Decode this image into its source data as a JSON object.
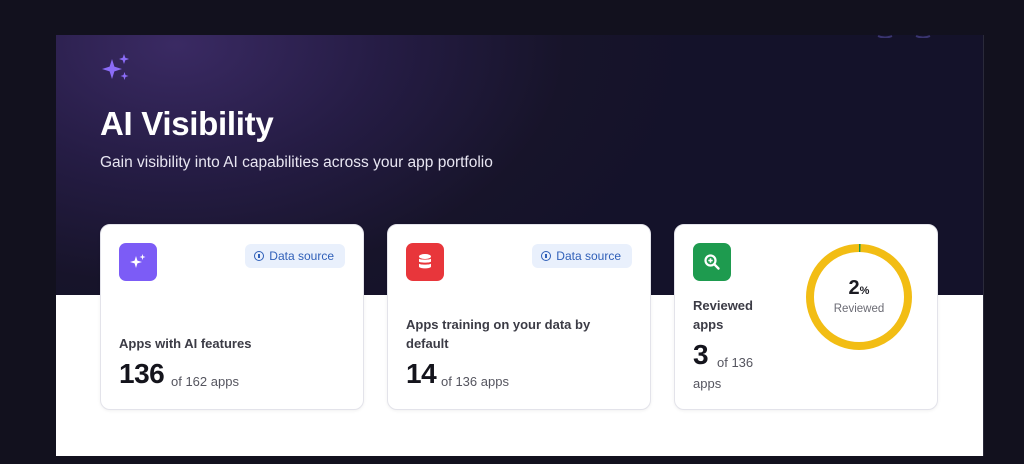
{
  "header": {
    "title": "AI Visibility",
    "subtitle": "Gain visibility into AI capabilities across your app portfolio"
  },
  "cards": [
    {
      "icon": "sparkle-icon",
      "tile_color": "#7c5cf6",
      "badge": "Data source",
      "label": "Apps with AI features",
      "value": "136",
      "suffix": "of 162 apps"
    },
    {
      "icon": "database-icon",
      "tile_color": "#e8363b",
      "badge": "Data source",
      "label_line1": "Apps training on your data by",
      "label_line2": "default",
      "value": "14",
      "suffix": "of 136 apps"
    },
    {
      "icon": "search-zoom-icon",
      "tile_color": "#1e9b4f",
      "label_line1": "Reviewed",
      "label_line2": "apps",
      "value": "3",
      "suffix_line1": "of 136",
      "suffix_line2": "apps",
      "progress": {
        "percent_number": "2",
        "percent_sign": "%",
        "label": "Reviewed",
        "fraction": 0.02,
        "fill_color": "#f2bd14",
        "done_color": "#1e9b4f"
      }
    }
  ],
  "colors": {
    "accent": "#8b6cf7",
    "badge_text": "#2f5fb8",
    "badge_bg": "#e9f0fc"
  }
}
